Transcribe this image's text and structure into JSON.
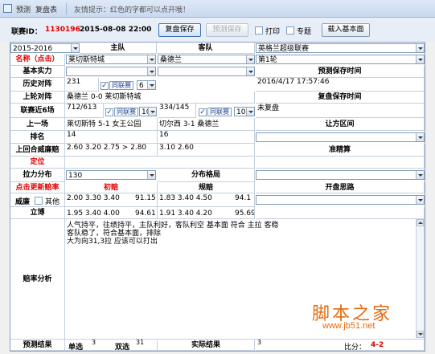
{
  "titlebar": {
    "tab1": "预测",
    "tab2": "复盘表",
    "tip": "友情提示：红色的字都可以点开哦！"
  },
  "toolbar": {
    "match_id_label": "联赛ID：",
    "match_id": "1130196",
    "datetime": "2015-08-08 22:00",
    "save_replay": "复盘保存",
    "save_predict": "预测保存",
    "print": "打印",
    "topic": "专题",
    "load_basic": "载入基本面"
  },
  "header": {
    "season": "2015-2016",
    "home": "主队",
    "away": "客队",
    "league": "英格兰超级联赛"
  },
  "rows": {
    "name": {
      "label": "名称（点击）",
      "home": "莱切斯特城",
      "away": "桑德兰",
      "round": "第1轮"
    },
    "strength": {
      "label": "基本实力",
      "right": "预测保存时间"
    },
    "h2h": {
      "label": "历史对阵",
      "val": "231",
      "same_league": "同联赛",
      "num": "6",
      "time": "2016/4/17 17:57:46"
    },
    "last_h2h": {
      "label": "上轮对阵",
      "val": "桑德兰 0-0 莱切斯特城",
      "right": "复盘保存时间"
    },
    "recent6": {
      "label": "联赛近6场",
      "home_val": "712/613",
      "same_league": "同联赛",
      "home_num": "10",
      "away_val": "334/145",
      "away_num": "10",
      "right": "未复盘"
    },
    "last_match": {
      "label": "上一场",
      "home": "莱切斯特 5-1 女王公园",
      "away": "切尔西 3-1 桑德兰",
      "right": "让方区间"
    },
    "rank": {
      "label": "排名",
      "home": "14",
      "away": "16"
    },
    "last_odds": {
      "label": "上回合威廉赔",
      "home": "2.60  3.20  2.75  > 2.80",
      "away": "3.10  2.60",
      "right": "准精算"
    },
    "position": {
      "label": "定位"
    },
    "pull": {
      "label": "拉力分布",
      "val": "130",
      "center": "分布格局"
    },
    "odds_hdr": {
      "label": "点击更新赔率",
      "initial": "初赔",
      "rule": "规赔",
      "thought": "开盘思路"
    },
    "william": {
      "label": "威廉",
      "other": "其他",
      "a": "2.00  3.30  3.40",
      "a_ret": "91.15",
      "b": "1.83  3.40  4.50",
      "b_ret": "94.1"
    },
    "libo": {
      "label": "立博",
      "a": "1.95  3.40  4.00",
      "a_ret": "94.61",
      "b": "1.91  3.40  4.20",
      "b_ret": "95.69"
    },
    "analysis": {
      "label": "赔率分析",
      "line1": "人气持平，往绩持平，主队利好，客队利空    基本面 符合 主拉 客稳",
      "line2": "客队稳了，符合基本面，排除",
      "line3": "大为向31,3拉  应该可以打出"
    },
    "result": {
      "label": "预测结果",
      "single": "单选",
      "single_val": "3",
      "double": "双选",
      "double_val": "31",
      "actual": "实际结果",
      "actual_val": "3",
      "ratio": "比分：",
      "score": "4-2"
    }
  },
  "watermark": {
    "cn": "脚本之家",
    "url": "www.jb51.net"
  },
  "colors": {
    "red": "#e00000",
    "title_blue": "#1b3f8f",
    "watermark": "#e56b12"
  }
}
